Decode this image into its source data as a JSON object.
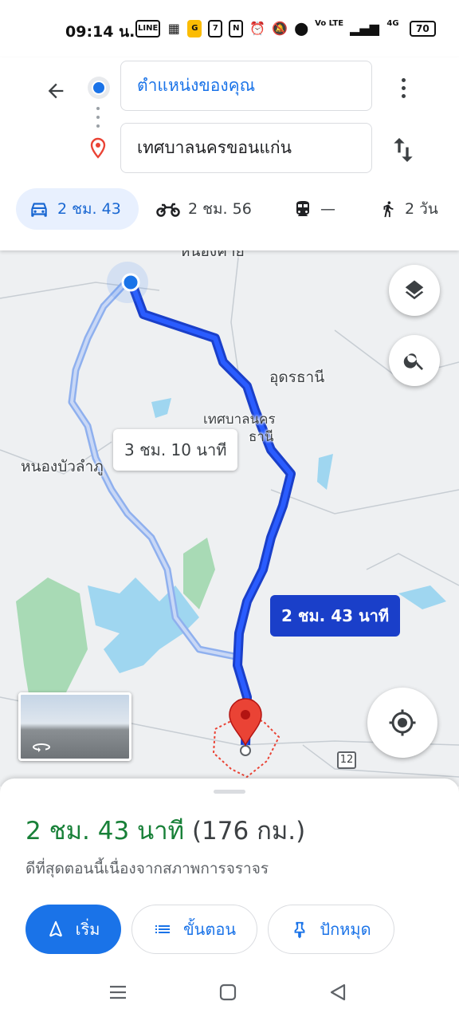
{
  "status_bar": {
    "time": "09:14 น.",
    "icons": [
      "line-icon",
      "film-icon",
      "g-app-icon",
      "seven-eleven-icon",
      "nfc-icon",
      "alarm-icon",
      "mute-icon",
      "location-icon",
      "volte-icon",
      "signal-icon",
      "4g-signal-icon"
    ],
    "volte_text": "Vo LTE",
    "network_text": "4G",
    "battery": "70"
  },
  "directions": {
    "origin": "ตำแหน่งของคุณ",
    "destination": "เทศบาลนครขอนแก่น",
    "modes": [
      {
        "name": "car",
        "label": "2 ชม. 43",
        "active": true
      },
      {
        "name": "motorcycle",
        "label": "2 ชม. 56",
        "active": false
      },
      {
        "name": "transit",
        "label": "—",
        "active": false
      },
      {
        "name": "walk",
        "label": "2 วัน",
        "active": false
      }
    ]
  },
  "map": {
    "labels": {
      "top_city": "หนองคาย",
      "udon": "อุดรธานี",
      "udon_muni_1": "เทศบาลนคร",
      "udon_muni_2": "ธานี",
      "nongbua": "หนองบัวลำภู"
    },
    "alt_route_time": "3 ชม. 10 นาที",
    "main_route_time": "2 ชม. 43 นาที",
    "highway_shield": "12",
    "colors": {
      "route_main": "#1a3fc9",
      "route_alt": "#a8c1f0",
      "water": "#9fd6f0",
      "park": "#a8dab5",
      "destination_pin": "#ea4335"
    }
  },
  "sheet": {
    "duration": "2 ชม. 43 นาที",
    "distance": "(176 กม.)",
    "subtext": "ดีที่สุดตอนนี้เนื่องจากสภาพการจราจร",
    "start_label": "เริ่ม",
    "steps_label": "ขั้นตอน",
    "pin_label": "ปักหมุด"
  }
}
